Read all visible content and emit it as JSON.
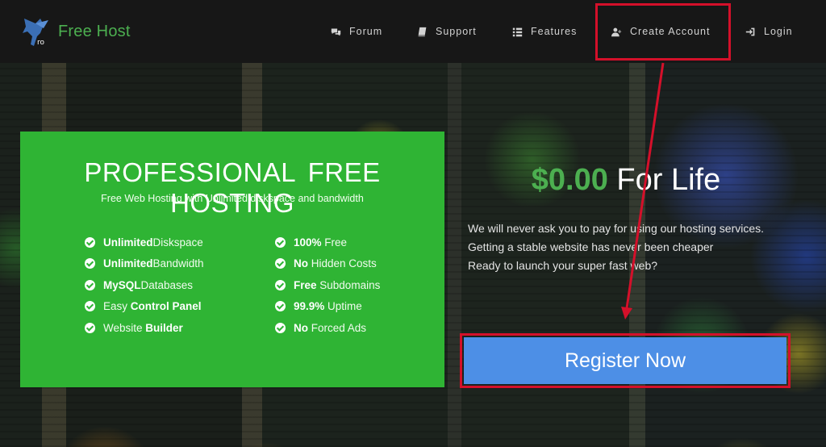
{
  "brand": {
    "name": "Free Host",
    "logo_icon": "pegasus-logo-icon"
  },
  "nav": {
    "items": [
      {
        "label": "Forum",
        "icon": "chat-bubbles-icon"
      },
      {
        "label": "Support",
        "icon": "book-icon"
      },
      {
        "label": "Features",
        "icon": "list-icon"
      },
      {
        "label": "Create Account",
        "icon": "user-plus-icon"
      },
      {
        "label": "Login",
        "icon": "sign-in-icon"
      }
    ]
  },
  "promo": {
    "title": "PROFESSIONAL FREE HOSTING",
    "subtitle": "Free Web Hosting with Unlimited diskspace and bandwidth",
    "features_left": [
      {
        "bold": "Unlimited",
        "text": " Diskspace"
      },
      {
        "bold": "Unlimited",
        "text": " Bandwidth"
      },
      {
        "bold": "MySQL",
        "text": " Databases"
      },
      {
        "pre": "Easy ",
        "bold": "Control Panel"
      },
      {
        "pre": "Website ",
        "bold": "Builder"
      }
    ],
    "features_right": [
      {
        "bold": "100%",
        "text": " Free"
      },
      {
        "bold": "No",
        "text": " Hidden Costs"
      },
      {
        "bold": "Free",
        "text": " Subdomains"
      },
      {
        "bold": "99.9%",
        "text": " Uptime"
      },
      {
        "bold": "No",
        "text": " Forced Ads"
      }
    ]
  },
  "pricing": {
    "amount": "$0.00",
    "suffix": " For Life",
    "lines": [
      "We will never ask you to pay for using our hosting services.",
      "Getting a stable website has never been cheaper",
      "Ready to launch your super fast web?"
    ]
  },
  "cta": {
    "register_label": "Register Now"
  },
  "colors": {
    "accent_green": "#2fb434",
    "price_green": "#4caf50",
    "button_blue": "#4d8fe6",
    "highlight_red": "#d4102a",
    "navbar": "#171717"
  }
}
